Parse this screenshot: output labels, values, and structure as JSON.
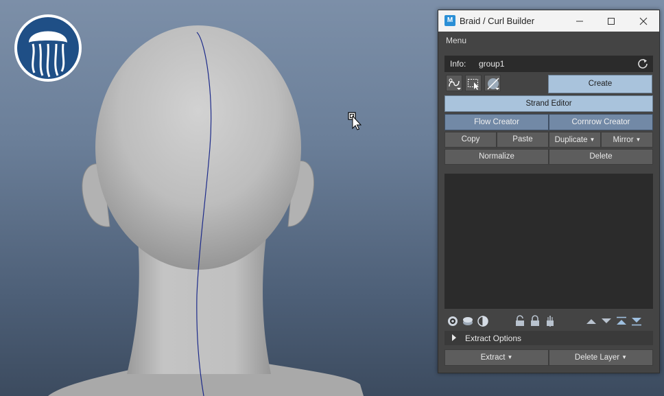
{
  "window": {
    "title": "Braid / Curl Builder",
    "app_icon": "M",
    "controls": [
      "minimize-icon",
      "maximize-icon",
      "close-icon"
    ]
  },
  "menubar": {
    "menu_label": "Menu"
  },
  "info": {
    "label": "Info:",
    "value": "group1",
    "refresh_icon": "refresh-icon"
  },
  "toolbar": {
    "icons": [
      "curve-dropdown-icon",
      "select-region-icon",
      "sphere-dropdown-icon"
    ],
    "create_label": "Create"
  },
  "buttons": {
    "strand_editor": "Strand Editor",
    "flow_creator": "Flow Creator",
    "cornrow_creator": "Cornrow Creator",
    "copy": "Copy",
    "paste": "Paste",
    "duplicate": "Duplicate",
    "mirror": "Mirror",
    "normalize": "Normalize",
    "delete": "Delete",
    "extract": "Extract",
    "delete_layer": "Delete Layer"
  },
  "layer_icons": [
    "visibility-icon",
    "stack-icon",
    "half-circle-icon",
    "lock-icon",
    "lock-all-icon",
    "lock-pin-icon",
    "move-up-icon",
    "move-down-icon",
    "move-top-icon",
    "move-bottom-icon"
  ],
  "extract_options": {
    "label": "Extract Options"
  },
  "colors": {
    "panel_bg": "#444444",
    "button_light": "#a9c3dc",
    "button_mid": "#7289a6",
    "button_dark": "#5d5d5d",
    "list_bg": "#2b2b2b"
  }
}
